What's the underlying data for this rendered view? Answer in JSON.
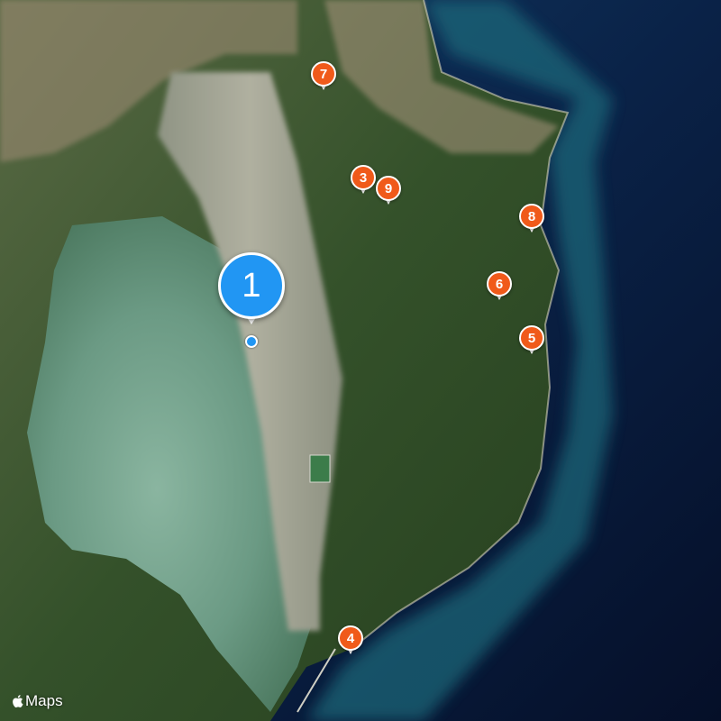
{
  "map": {
    "type": "satellite",
    "colors": {
      "sea_deep": "#0a1a38",
      "sea_mid": "#14406a",
      "lagoon": "#6f9f8a",
      "land": "#3f5a2c",
      "runway": "#a3a394",
      "pin": "#f05a1a",
      "primary_pin": "#2196f3"
    }
  },
  "primary_marker": {
    "label": "1",
    "icon": "location-dot-icon"
  },
  "markers": [
    {
      "label": "3"
    },
    {
      "label": "4"
    },
    {
      "label": "5"
    },
    {
      "label": "6"
    },
    {
      "label": "7"
    },
    {
      "label": "8"
    },
    {
      "label": "9"
    }
  ],
  "attribution": {
    "text": "Maps",
    "icon": "apple-logo-icon"
  }
}
